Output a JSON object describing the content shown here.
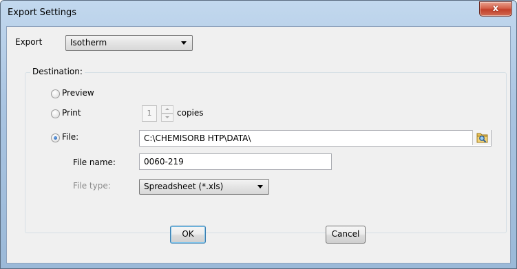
{
  "window": {
    "title": "Export Settings",
    "close_label": "x"
  },
  "export": {
    "label": "Export",
    "selected": "Isotherm"
  },
  "destination": {
    "caption": "Destination:",
    "preview_label": "Preview",
    "print_label": "Print",
    "copies_value": "1",
    "copies_label": "copies",
    "file_label": "File:",
    "file_path": "C:\\CHEMISORB HTP\\DATA\\",
    "file_name_label": "File name:",
    "file_name_value": "0060-219",
    "file_type_label": "File type:",
    "file_type_selected": "Spreadsheet (*.xls)",
    "selected_option": "File"
  },
  "buttons": {
    "ok": "OK",
    "cancel": "Cancel"
  },
  "icons": {
    "browse": "folder-search-icon",
    "close": "close-icon"
  },
  "colors": {
    "titlebar": "#a9c4e1",
    "close_button": "#c2402a",
    "radio_checked": "#1d57a8"
  }
}
